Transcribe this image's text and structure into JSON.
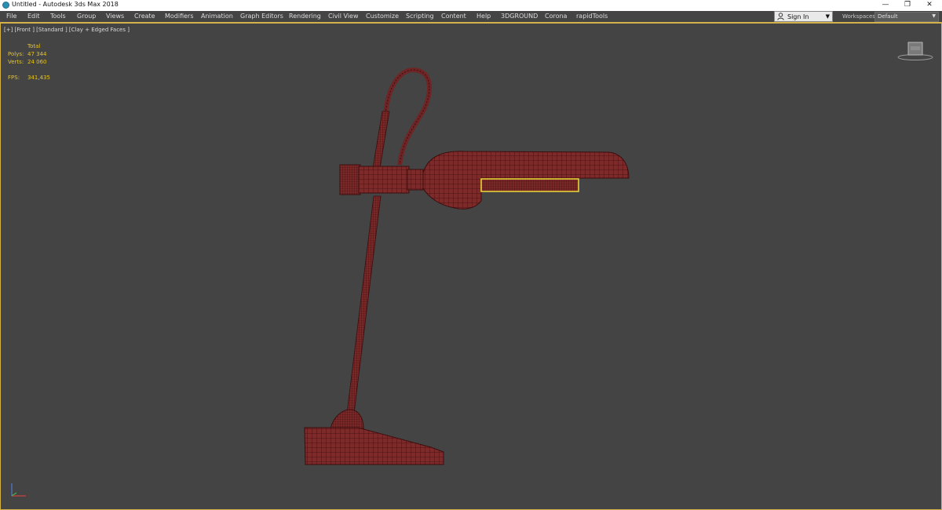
{
  "window": {
    "title": "Untitled - Autodesk 3ds Max 2018",
    "icons": {
      "app": "3dsmax-app-icon",
      "minimize": "minimize-icon",
      "restore": "restore-icon",
      "close": "close-icon"
    }
  },
  "menu": {
    "items": [
      "File",
      "Edit",
      "Tools",
      "Group",
      "Views",
      "Create",
      "Modifiers",
      "Animation",
      "Graph Editors",
      "Rendering",
      "Civil View",
      "Customize",
      "Scripting",
      "Content",
      "Help",
      "3DGROUND",
      "Corona",
      "rapidTools"
    ],
    "sign_in": "Sign In",
    "workspaces_label": "Workspaces:",
    "workspace_value": "Default"
  },
  "viewport": {
    "label": "[+] [Front ] [Standard ] [Clay + Edged Faces ]",
    "stats": {
      "header": "Total",
      "polys_label": "Polys:",
      "polys_value": "47 344",
      "verts_label": "Verts:",
      "verts_value": "24 060",
      "fps_label": "FPS:",
      "fps_value": "341,435"
    },
    "model_color": "#7a2b2b",
    "wire_color": "#3a0f0f",
    "selection_color": "#e8d23a"
  }
}
